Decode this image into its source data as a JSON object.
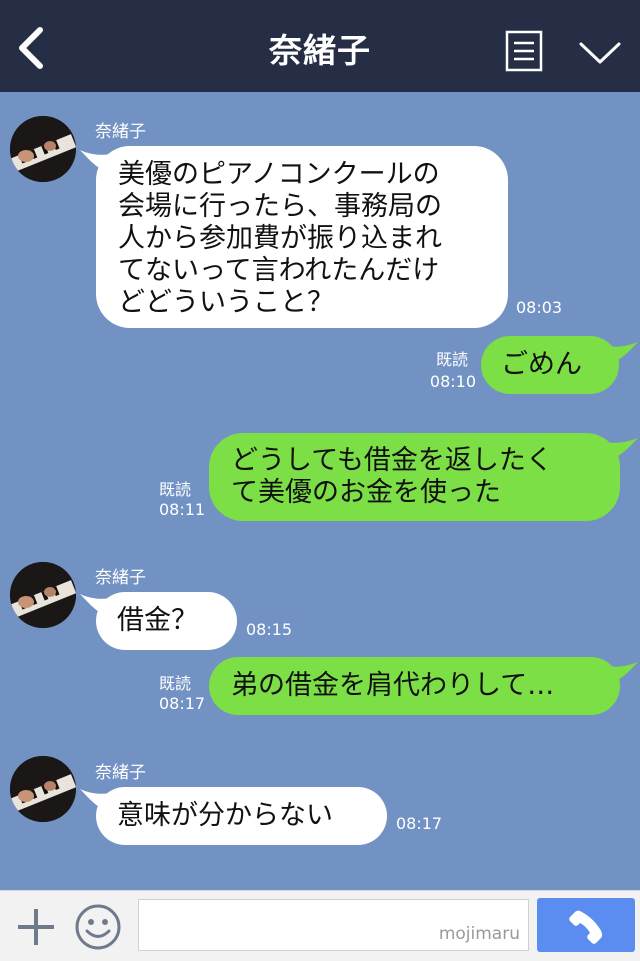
{
  "header": {
    "title": "奈緒子",
    "back_icon": "chevron-left-icon",
    "menu_icon": "list-icon",
    "collapse_icon": "chevron-down-icon"
  },
  "messages": [
    {
      "direction": "in",
      "sender": "奈緒子",
      "text": "美優のピアノコンクールの\n会場に行ったら、事務局の\n人から参加費が振り込まれ\nてないって言われたんだけ\nどどういうこと？",
      "time": "08:03"
    },
    {
      "direction": "out",
      "text": "ごめん",
      "read": "既読",
      "time": "08:10"
    },
    {
      "direction": "out",
      "text": "どうしても借金を返したく\nて美優のお金を使った",
      "read": "既読",
      "time": "08:11"
    },
    {
      "direction": "in",
      "sender": "奈緒子",
      "text": "借金？",
      "time": "08:15"
    },
    {
      "direction": "out",
      "text": "弟の借金を肩代わりして…",
      "read": "既読",
      "time": "08:17"
    },
    {
      "direction": "in",
      "sender": "奈緒子",
      "text": "意味が分からない",
      "time": "08:17"
    }
  ],
  "footer": {
    "plus_icon": "plus-icon",
    "sticker_icon": "smiley-icon",
    "input_value": "",
    "input_placeholder": "",
    "watermark": "mojimaru",
    "call_icon": "phone-icon"
  },
  "colors": {
    "header_bg": "#252e45",
    "chat_bg": "#7392c4",
    "incoming_bubble": "#ffffff",
    "outgoing_bubble": "#7cdf45",
    "call_button": "#5b8cf0"
  }
}
